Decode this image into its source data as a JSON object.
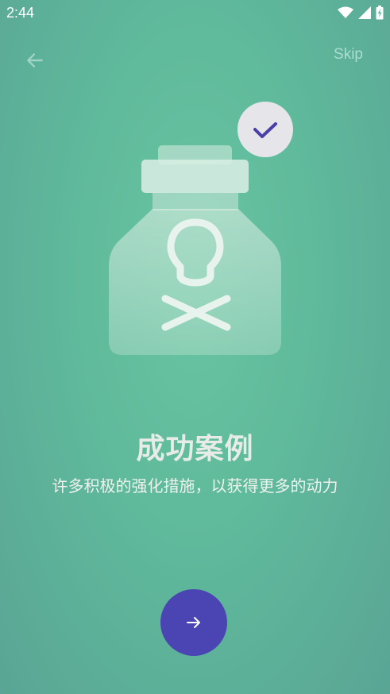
{
  "status_bar": {
    "time": "2:44",
    "icons": [
      "wifi-icon",
      "cell-signal-icon",
      "battery-charging-icon"
    ]
  },
  "nav": {
    "back_icon": "arrow-left-icon",
    "skip_label": "Skip"
  },
  "illustration": {
    "subject": "poison-bottle",
    "badge_icon": "check-icon"
  },
  "content": {
    "title": "成功案例",
    "subtitle": "许多积极的强化措施，以获得更多的动力"
  },
  "next_button": {
    "icon": "arrow-right-icon"
  },
  "colors": {
    "accent": "#4a45b2",
    "background_top": "#68c5a2",
    "background_bottom": "#5aa595"
  }
}
